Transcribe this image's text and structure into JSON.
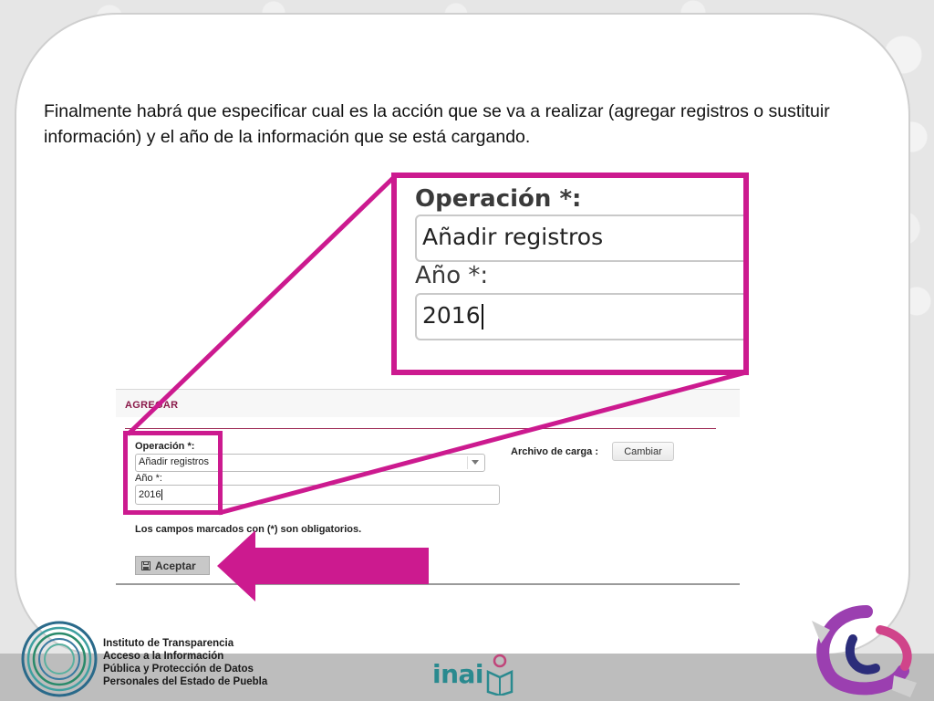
{
  "intro": {
    "text": "Finalmente habrá que especificar cual es la acción que se va a realizar (agregar registros o sustituir información) y el año de la información que se está cargando."
  },
  "zoom": {
    "operation_label": "Operación *:",
    "operation_value": "Añadir registros",
    "year_label": "Año *:",
    "year_value": "2016"
  },
  "form": {
    "section_title": "AGREGAR",
    "operation_label": "Operación *:",
    "operation_selected": "Añadir registros",
    "year_label": "Año *:",
    "year_value": "2016",
    "file_label": "Archivo de carga :",
    "change_button": "Cambiar",
    "required_note": "Los campos marcados con (*) son obligatorios.",
    "accept_button": "Aceptar"
  },
  "footer": {
    "institute_lines": [
      "Instituto de Transparencia",
      "Acceso a la Información",
      "Pública y Protección de Datos",
      "Personales del Estado de Puebla"
    ],
    "inai": "inai"
  },
  "colors": {
    "highlight": "#cc1a8f",
    "title_accent": "#8a1a4a",
    "inai_teal": "#2a8a8f"
  }
}
